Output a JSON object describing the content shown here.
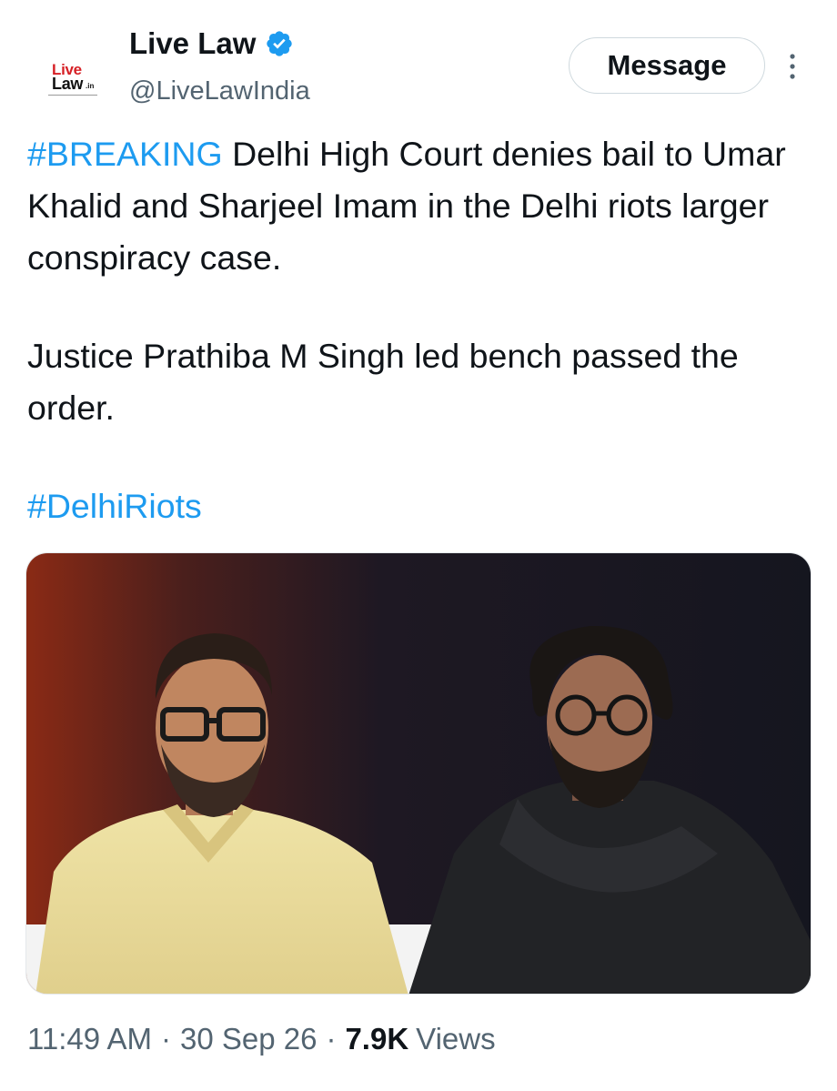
{
  "author": {
    "display_name": "Live Law",
    "handle": "@LiveLawIndia",
    "verified": true,
    "avatar_logo_text_top": "Live",
    "avatar_logo_text_bottom": "Law",
    "avatar_logo_suffix": ".in"
  },
  "actions": {
    "message_label": "Message",
    "more_icon": "more-vertical-icon"
  },
  "tweet": {
    "line1_hashtag": "#BREAKING",
    "line1_text": " Delhi High Court denies bail to Umar Khalid and Sharjeel Imam in the Delhi riots larger conspiracy case.",
    "paragraph2": "Justice Prathiba M Singh led bench passed the order.",
    "hashtag2": "#DelhiRiots"
  },
  "media": {
    "type": "photo"
  },
  "meta": {
    "time": "11:49 AM",
    "separator": "·",
    "date": "30 Sep 26",
    "views_count": "7.9K",
    "views_label": "Views"
  },
  "colors": {
    "link": "#1d9bf0",
    "verified": "#1d9bf0",
    "secondary_text": "#536471",
    "primary_text": "#0f1419",
    "brand_red": "#d62026"
  }
}
